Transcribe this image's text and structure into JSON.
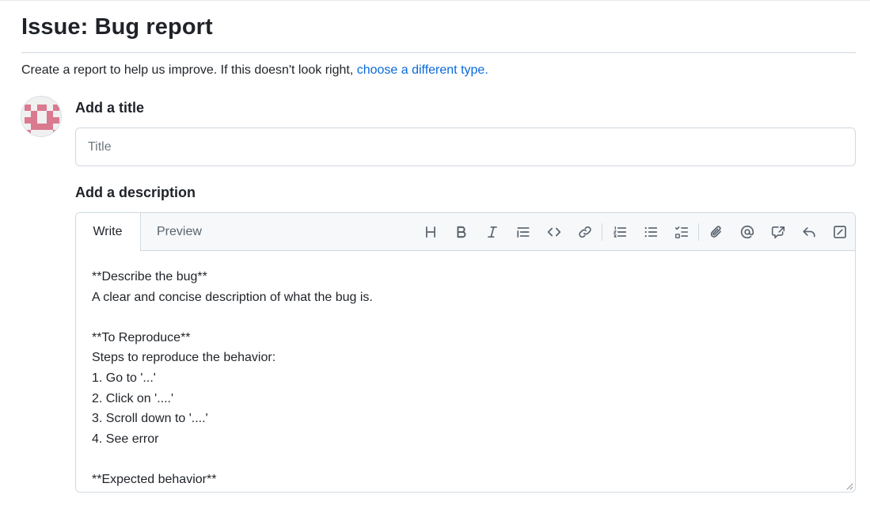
{
  "page": {
    "title": "Issue: Bug report",
    "intro_text": "Create a report to help us improve. If this doesn't look right, ",
    "intro_link": "choose a different type."
  },
  "form": {
    "title_label": "Add a title",
    "title_placeholder": "Title",
    "title_value": "",
    "description_label": "Add a description"
  },
  "editor": {
    "tabs": [
      {
        "label": "Write",
        "active": true
      },
      {
        "label": "Preview",
        "active": false
      }
    ],
    "toolbar": [
      {
        "icon": "heading-icon"
      },
      {
        "icon": "bold-icon"
      },
      {
        "icon": "italic-icon"
      },
      {
        "icon": "quote-icon"
      },
      {
        "icon": "code-icon"
      },
      {
        "icon": "link-icon"
      },
      {
        "icon": "ordered-list-icon"
      },
      {
        "icon": "unordered-list-icon"
      },
      {
        "icon": "task-list-icon"
      },
      {
        "icon": "attach-icon"
      },
      {
        "icon": "mention-icon"
      },
      {
        "icon": "reference-icon"
      },
      {
        "icon": "saved-reply-icon"
      },
      {
        "icon": "slash-commands-icon"
      }
    ],
    "lines": [
      "**Describe the bug**",
      "A clear and concise description of what the bug is.",
      "",
      "**To Reproduce**",
      "Steps to reproduce the behavior:",
      "1. Go to '...'",
      "2. Click on '....'",
      "3. Scroll down to '....'",
      "4. See error",
      "",
      "**Expected behavior**"
    ]
  },
  "colors": {
    "link": "#0969da",
    "border": "#d1d9e0",
    "toolbar_bg": "#f6f8fa",
    "avatar": "#d97a8f"
  }
}
